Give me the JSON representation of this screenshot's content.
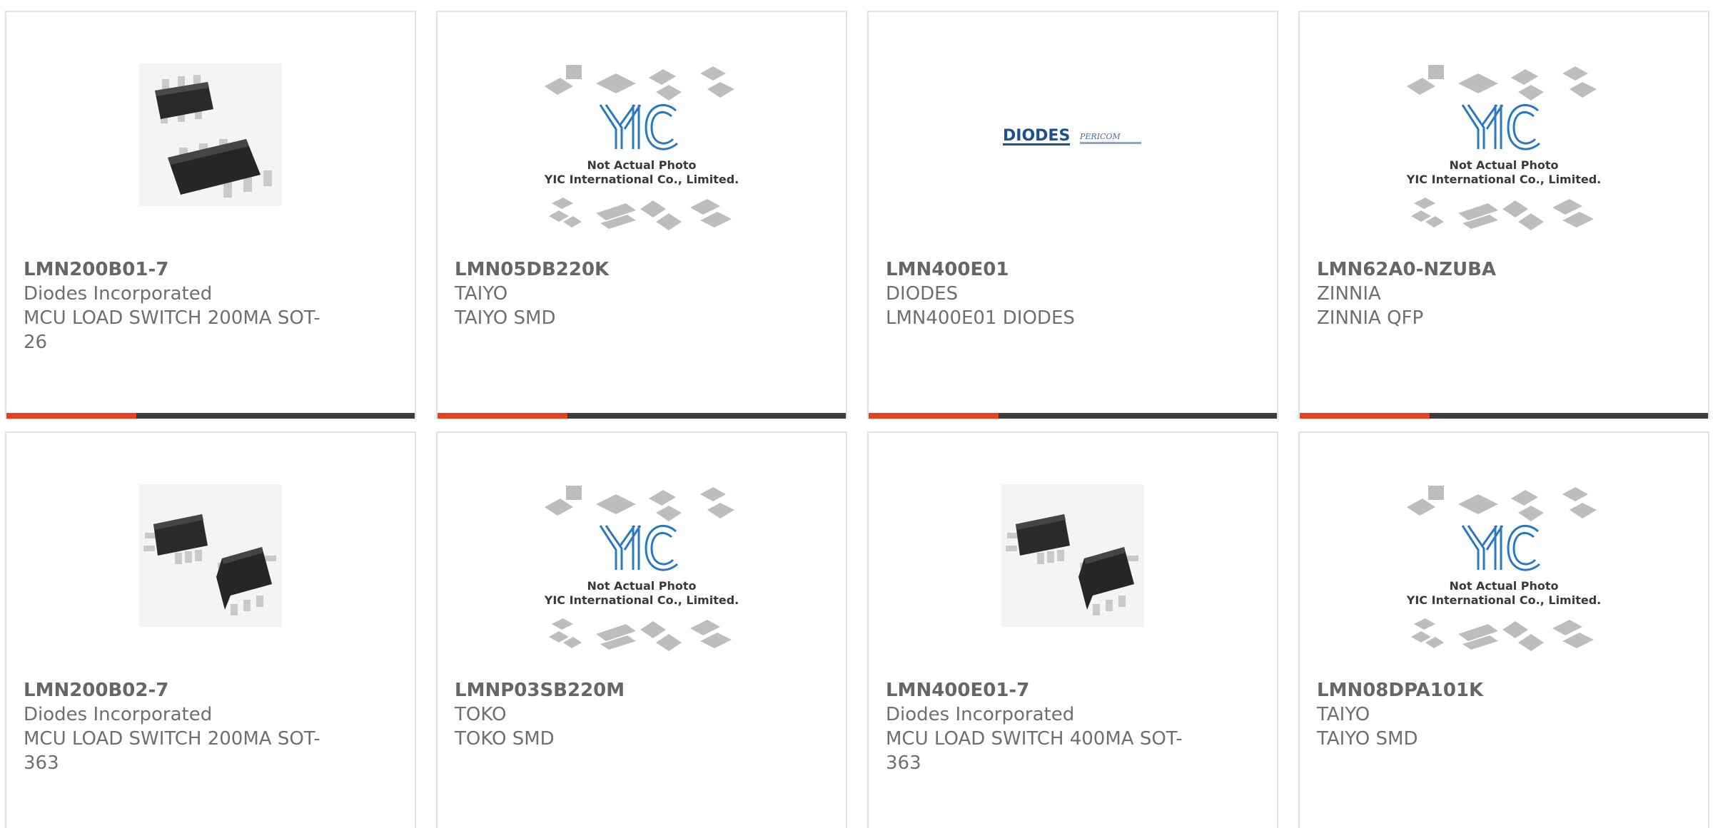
{
  "products": [
    {
      "part": "LMN200B01-7",
      "manufacturer": "Diodes Incorporated",
      "description": "MCU LOAD SWITCH 200MA SOT-26",
      "image": "sot26-package-photo"
    },
    {
      "part": "LMN05DB220K",
      "manufacturer": "TAIYO",
      "description": "TAIYO SMD",
      "image": "yic-placeholder"
    },
    {
      "part": "LMN400E01",
      "manufacturer": "DIODES",
      "description": "LMN400E01 DIODES",
      "image": "diodes-pericom-logo"
    },
    {
      "part": "LMN62A0-NZUBA",
      "manufacturer": "ZINNIA",
      "description": "ZINNIA QFP",
      "image": "yic-placeholder"
    },
    {
      "part": "LMN200B02-7",
      "manufacturer": "Diodes Incorporated",
      "description": "MCU LOAD SWITCH 200MA SOT-363",
      "image": "sot363-package-photo"
    },
    {
      "part": "LMNP03SB220M",
      "manufacturer": "TOKO",
      "description": "TOKO SMD",
      "image": "yic-placeholder"
    },
    {
      "part": "LMN400E01-7",
      "manufacturer": "Diodes Incorporated",
      "description": "MCU LOAD SWITCH 400MA SOT-363",
      "image": "sot363-package-photo"
    },
    {
      "part": "LMN08DPA101K",
      "manufacturer": "TAIYO",
      "description": "TAIYO SMD",
      "image": "yic-placeholder"
    }
  ],
  "placeholder": {
    "line1": "Not Actual Photo",
    "line2": "YIC International Co., Limited.",
    "logo": "YIC"
  },
  "diodes_logo": {
    "brand": "DIODES",
    "sub_brand": "PERICOM"
  },
  "colors": {
    "accent": "#e8401c",
    "bar": "#3c3c3c",
    "text": "#6f6f6f",
    "border": "#e2e2e2",
    "yic_blue": "#2a78c2"
  }
}
